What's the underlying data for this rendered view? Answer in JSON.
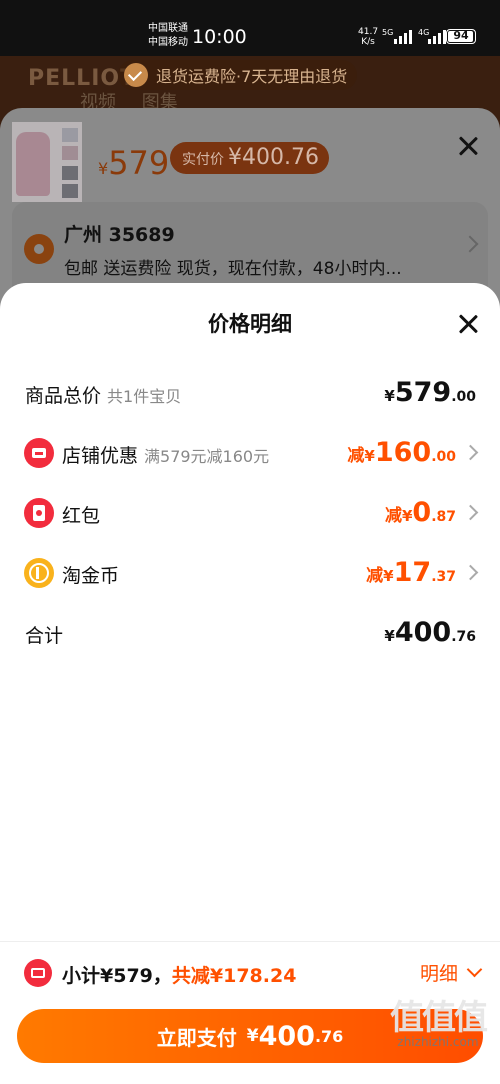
{
  "status_bar": {
    "carrier1": "中国联通",
    "carrier2": "中国移动",
    "time": "10:00",
    "net_speed_value": "41.7",
    "net_speed_unit": "K/s",
    "signal1_label": "5G",
    "signal2_label": "4G",
    "battery": "94"
  },
  "background_page": {
    "brand": "PELLIOT",
    "tabs": [
      "视频",
      "图集"
    ],
    "notice": "退货运费险·7天无理由退货"
  },
  "sku_panel": {
    "price_yen": "¥",
    "price": "579",
    "actual_label": "实付价",
    "actual_price": "¥400.76",
    "address_title": "广州 35689",
    "address_sub": "包邮 送运费险 现货，现在付款，48小时内..."
  },
  "price_detail": {
    "title": "价格明细",
    "rows": [
      {
        "label": "商品总价",
        "sub": "共1件宝贝",
        "prefix": "",
        "yen": "¥",
        "int": "579",
        "dec": ".00",
        "icon": ""
      },
      {
        "label": "店铺优惠",
        "sub": "满579元减160元",
        "prefix": "减",
        "yen": "¥",
        "int": "160",
        "dec": ".00",
        "icon": "shop-icon"
      },
      {
        "label": "红包",
        "sub": "",
        "prefix": "减",
        "yen": "¥",
        "int": "0",
        "dec": ".87",
        "icon": "red-packet-icon"
      },
      {
        "label": "淘金币",
        "sub": "",
        "prefix": "减",
        "yen": "¥",
        "int": "17",
        "dec": ".37",
        "icon": "coin-icon"
      },
      {
        "label": "合计",
        "sub": "",
        "prefix": "",
        "yen": "¥",
        "int": "400",
        "dec": ".76",
        "icon": ""
      }
    ]
  },
  "bottom_bar": {
    "subtotal": "小计¥579，",
    "saved": "共减¥178.24",
    "detail_label": "明细",
    "pay_label": "立即支付",
    "pay_yen": "¥",
    "pay_int": "400",
    "pay_dec": ".76"
  },
  "watermark": {
    "big": "值值值",
    "small": "zhizhizhi.com"
  },
  "colors": {
    "accent": "#ff5000",
    "coupon_red": "#f22c3d",
    "coin_yellow": "#f9b21c"
  }
}
